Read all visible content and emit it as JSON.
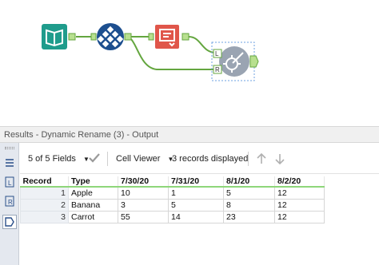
{
  "colors": {
    "input_tool": "#1f9c8c",
    "select_tool": "#1d4f8f",
    "formula_tool": "#e0564a",
    "dynamic_rename_tool": "#9aa4b2",
    "connector": "#64a63f",
    "port": "#b8e08f",
    "selection": "#6ea0e0",
    "header_underline": "#8ed67a"
  },
  "workflow": {
    "tools": [
      {
        "name": "Input Data",
        "icon": "book-icon"
      },
      {
        "name": "Select",
        "icon": "grid-diamond-icon"
      },
      {
        "name": "Formula",
        "icon": "formula-icon"
      },
      {
        "name": "Dynamic Rename",
        "icon": "gear-pencil-icon"
      }
    ],
    "port_labels": {
      "left": "L",
      "right": "R"
    }
  },
  "results": {
    "title": "Results - Dynamic Rename (3) - Output",
    "fields_selector": "5 of 5 Fields",
    "viewer": "Cell Viewer",
    "records_status": "3 records displayed"
  },
  "table": {
    "columns": [
      "Record",
      "Type",
      "7/30/20",
      "7/31/20",
      "8/1/20",
      "8/2/20"
    ],
    "rows": [
      [
        "1",
        "Apple",
        "10",
        "1",
        "5",
        "12"
      ],
      [
        "2",
        "Banana",
        "3",
        "5",
        "8",
        "12"
      ],
      [
        "3",
        "Carrot",
        "55",
        "14",
        "23",
        "12"
      ]
    ]
  }
}
